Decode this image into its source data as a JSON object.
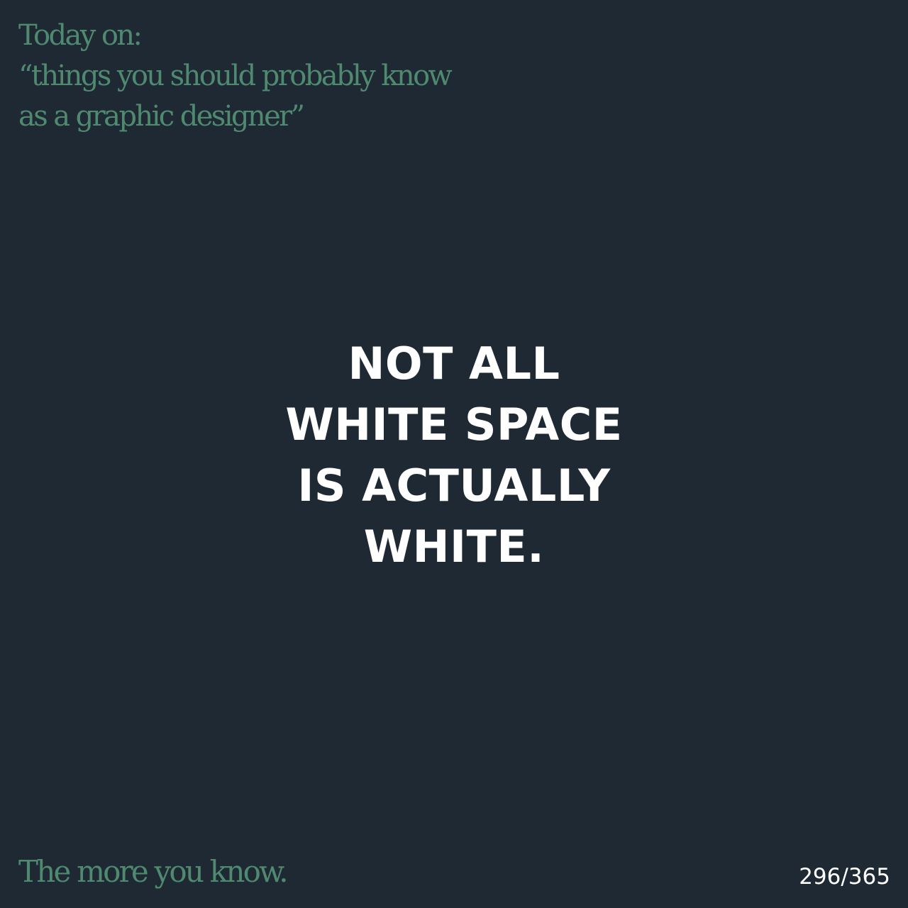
{
  "colors": {
    "background": "#1e2933",
    "accent": "#4f8a70",
    "text": "#ffffff"
  },
  "header": {
    "lines": [
      "Today on:",
      "“things you should probably know",
      "as a graphic designer”"
    ]
  },
  "headline": {
    "lines": [
      "NOT ALL",
      "WHITE SPACE",
      "IS ACTUALLY",
      "WHITE."
    ]
  },
  "footer": {
    "tagline": "The more you know.",
    "counter": "296/365"
  }
}
